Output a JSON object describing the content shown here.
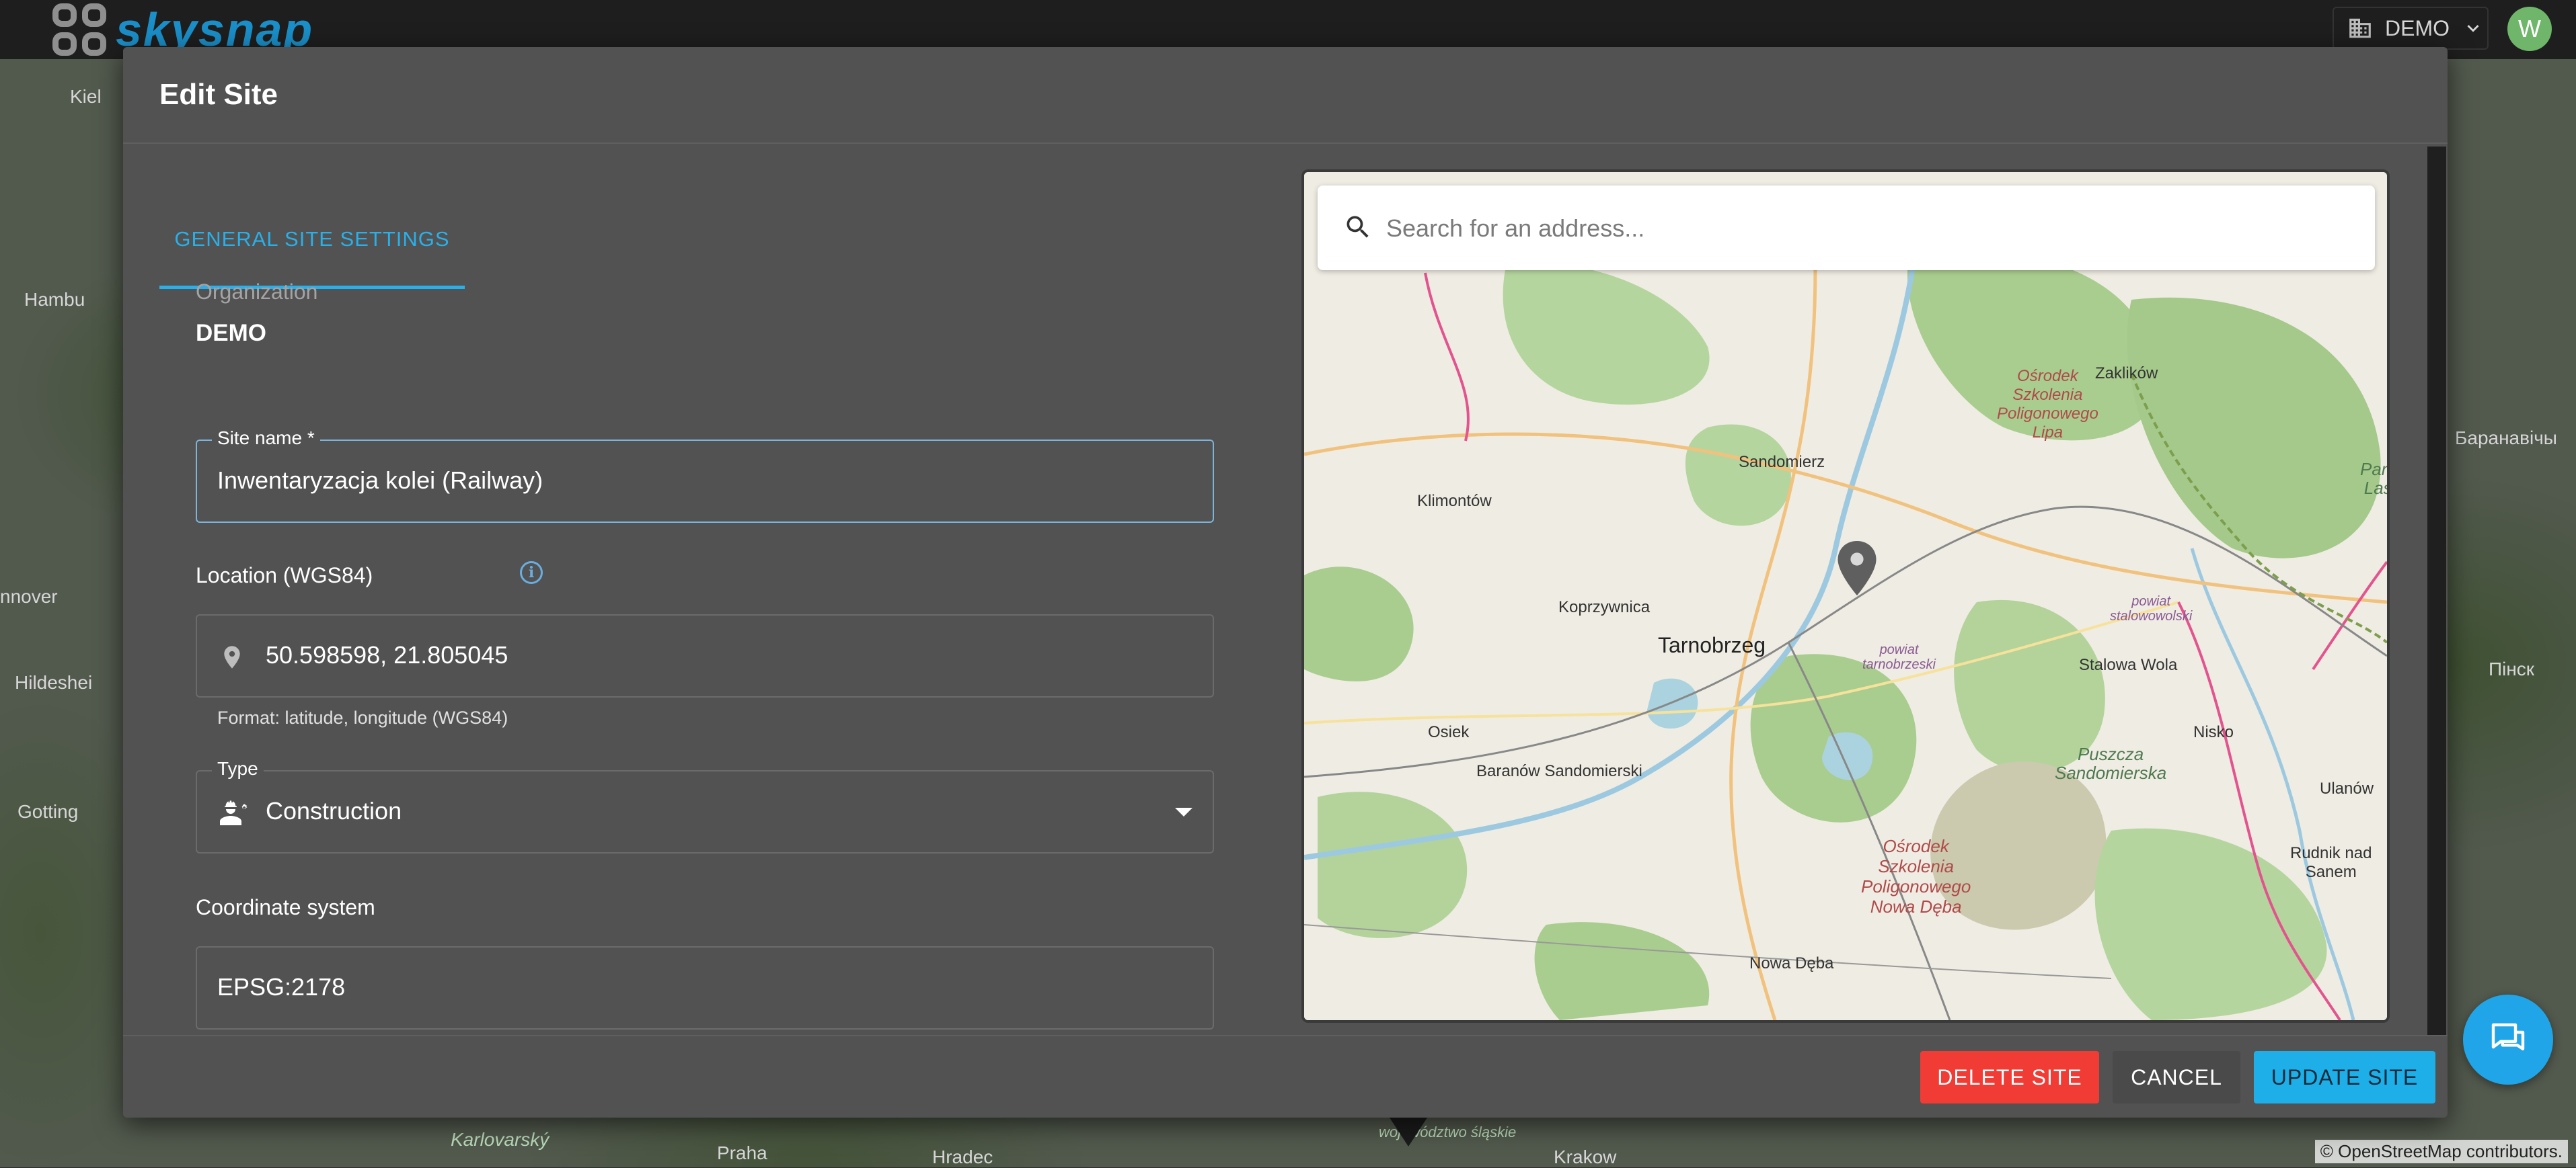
{
  "app": {
    "brand": "skysnap",
    "org_switch_label": "DEMO",
    "user_initial": "W"
  },
  "background_map": {
    "labels": [
      "Kiel",
      "Hambu",
      "nnover",
      "Hildeshei",
      "Gotting",
      "Praha",
      "Karlovarský",
      "Hradec",
      "Баранавічы",
      "Пінск",
      "Krakow",
      "województwo śląskie"
    ],
    "attribution": "© OpenStreetMap contributors."
  },
  "dialog": {
    "title": "Edit Site",
    "tabs": [
      {
        "label": "GENERAL SITE SETTINGS",
        "active": true
      }
    ],
    "organization": {
      "label": "Organization",
      "value": "DEMO"
    },
    "site_name": {
      "label": "Site name *",
      "value": "Inwentaryzacja kolei (Railway)"
    },
    "location": {
      "label": "Location (WGS84)",
      "value": "50.598598, 21.805045",
      "helper": "Format: latitude, longitude (WGS84)"
    },
    "type": {
      "label": "Type",
      "value": "Construction"
    },
    "coordinate_system": {
      "label": "Coordinate system",
      "value": "EPSG:2178"
    }
  },
  "map": {
    "search_placeholder": "Search for an address...",
    "places": {
      "sandomierz": "Sandomierz",
      "klimontow": "Klimontów",
      "koprzywnica": "Koprzywnica",
      "tarnobrzeg": "Tarnobrzeg",
      "osiek": "Osiek",
      "baranow": "Baranów Sandomierski",
      "nowa_deba": "Nowa Dęba",
      "stalowa_wola": "Stalowa Wola",
      "nisko": "Nisko",
      "ulanow": "Ulanów",
      "rudnik": "Rudnik nad\nSanem",
      "zaklikow": "Zaklików",
      "osrodek_lipa": "Ośrodek\nSzkolenia\nPoligonowego\nLipa",
      "osrodek_nowa_deba": "Ośrodek\nSzkolenia\nPoligonowego\nNowa Dęba",
      "powiat_tarnobrzeski": "powiat\ntarnobrzeski",
      "powiat_stalowowolski": "powiat\nstalowowolski",
      "puszcza": "Puszcza\nSandomierska",
      "park": "Park\nLas"
    }
  },
  "footer": {
    "delete_label": "DELETE SITE",
    "cancel_label": "CANCEL",
    "update_label": "UPDATE SITE"
  },
  "colors": {
    "accent": "#29b0ea",
    "danger": "#f13c36",
    "primary_button": "#1eaee8"
  }
}
